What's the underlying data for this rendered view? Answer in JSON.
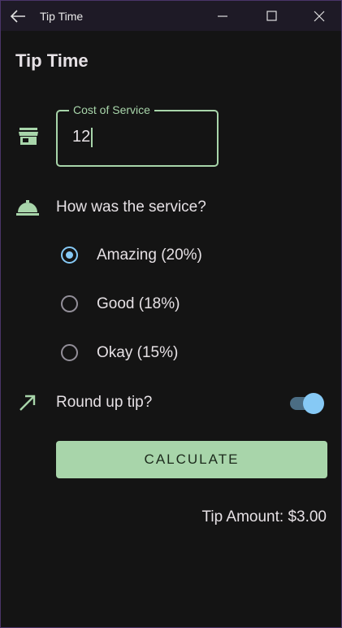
{
  "window": {
    "title": "Tip Time",
    "controls": [
      "back-icon",
      "minimize-icon",
      "maximize-icon",
      "close-icon"
    ]
  },
  "app": {
    "title": "Tip Time"
  },
  "cost_field": {
    "label": "Cost of Service",
    "value": "12",
    "icon": "store-icon"
  },
  "service": {
    "question": "How was the service?",
    "icon": "room-service-icon",
    "options": [
      {
        "label": "Amazing (20%)",
        "selected": true
      },
      {
        "label": "Good (18%)",
        "selected": false
      },
      {
        "label": "Okay (15%)",
        "selected": false
      }
    ]
  },
  "round_up": {
    "label": "Round up tip?",
    "icon": "trending-up-icon",
    "on": true
  },
  "calculate_button": {
    "label": "CALCULATE"
  },
  "result": {
    "text": "Tip Amount: $3.00"
  },
  "colors": {
    "background": "#141414",
    "primary": "#a8d5aa",
    "accent": "#86c9f5",
    "on_surface": "#e6e1e5"
  }
}
